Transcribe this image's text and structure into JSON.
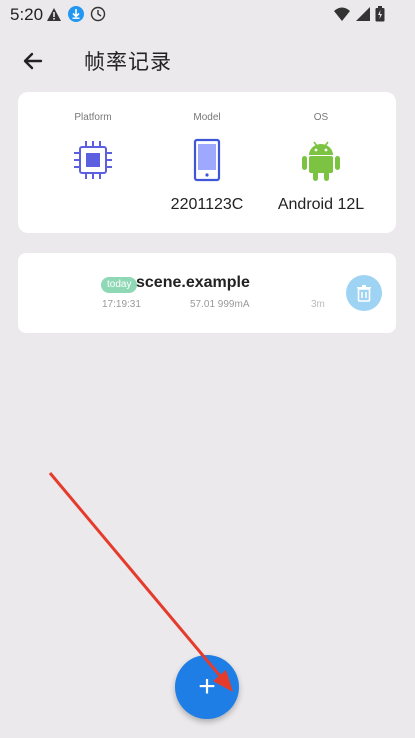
{
  "status_bar": {
    "time": "5:20",
    "left_icons": [
      "warning-icon",
      "download-icon",
      "clock-icon"
    ],
    "right_icons": [
      "wifi-icon",
      "signal-icon",
      "battery-icon"
    ]
  },
  "app_bar": {
    "title": "帧率记录",
    "back_icon": "arrow-left-icon"
  },
  "device_info": {
    "platform": {
      "label": "Platform",
      "icon": "cpu-icon",
      "value": ""
    },
    "model": {
      "label": "Model",
      "icon": "phone-icon",
      "value": "2201123C"
    },
    "os": {
      "label": "OS",
      "icon": "android-icon",
      "value": "Android 12L"
    }
  },
  "records": [
    {
      "badge": "today",
      "name": "scene.example",
      "time": "17:19:31",
      "stats": "57.01  999mA",
      "duration": "3m",
      "delete_icon": "trash-icon"
    }
  ],
  "fab": {
    "label": "+"
  },
  "colors": {
    "background": "#ebe9eb",
    "accent": "#1f7ee6",
    "badge": "#8fd8b6",
    "delete": "#9fd3f3",
    "cpu": "#5b5fe0",
    "android": "#7cc341",
    "arrow": "#e53b2c"
  }
}
